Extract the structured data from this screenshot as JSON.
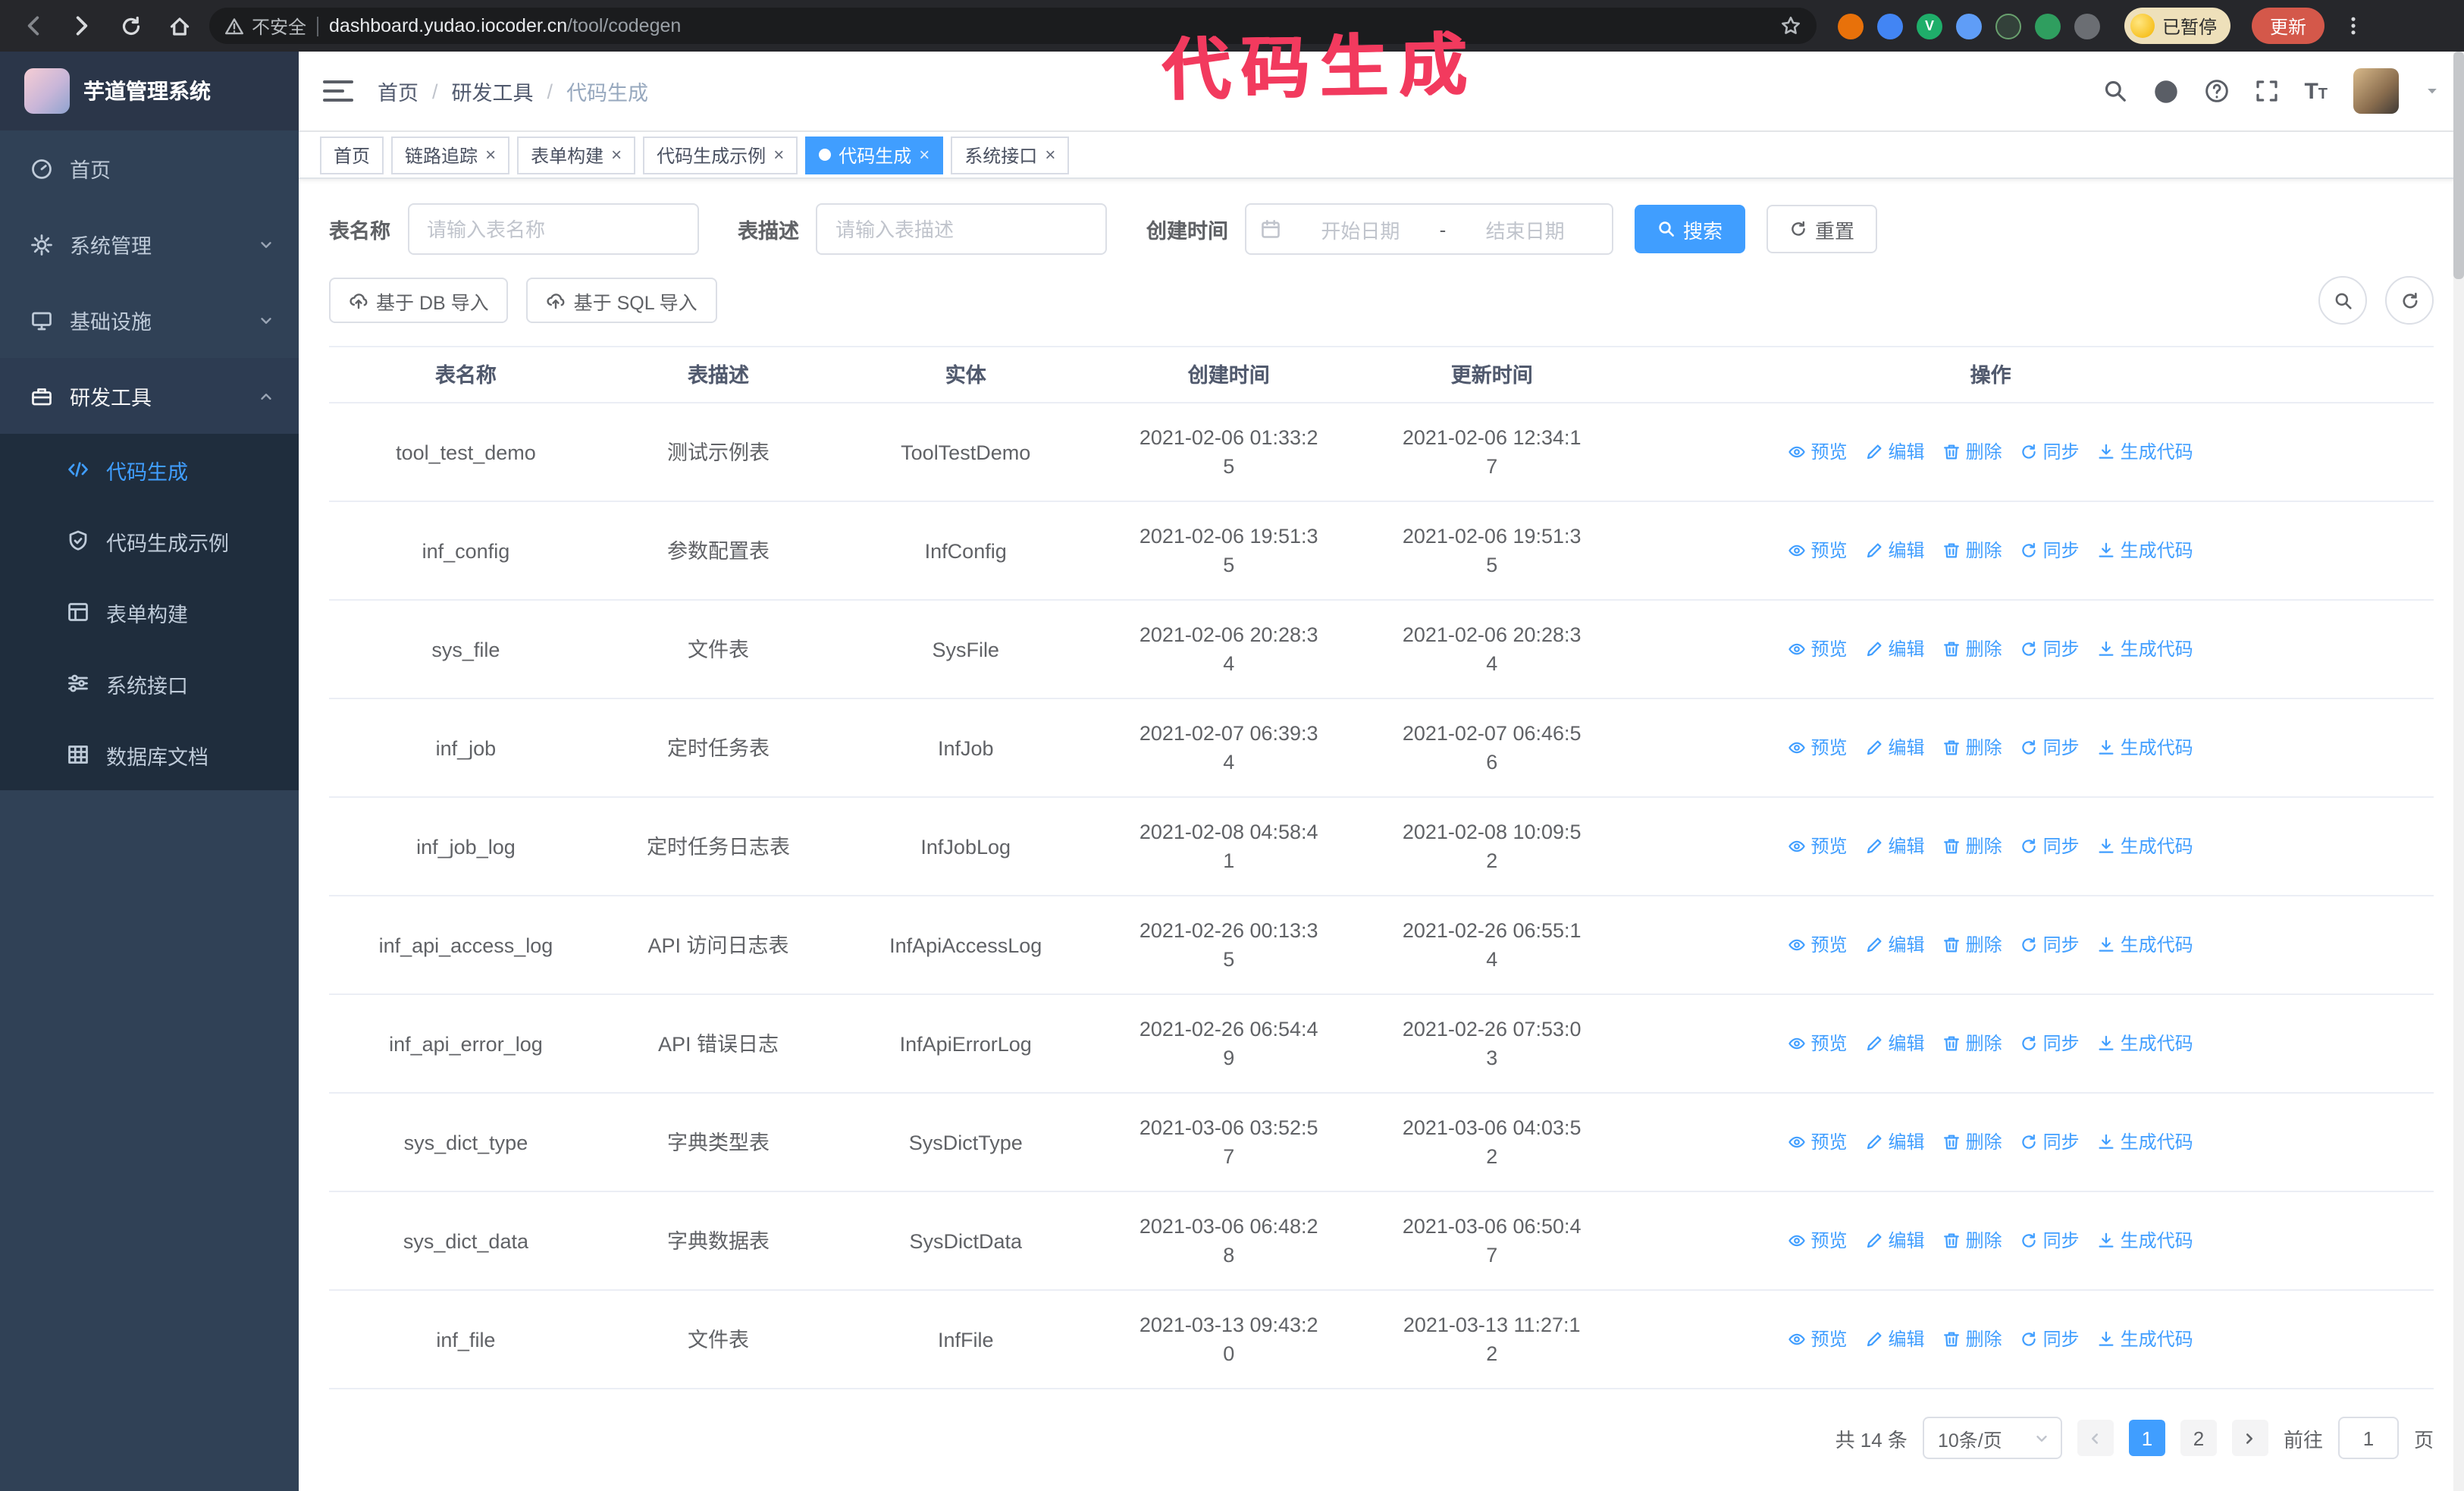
{
  "colors": {
    "accent": "#409eff",
    "annotation": "#f23a5e",
    "sidebar_bg": "#304156",
    "submenu_bg": "#1f2d3d"
  },
  "annotation": {
    "text": "代码生成"
  },
  "browser": {
    "security_label": "不安全",
    "url_domain": "dashboard.yudao.iocoder.cn",
    "url_path": "/tool/codegen",
    "profile_badge": "已暂停",
    "update_label": "更新"
  },
  "app": {
    "logo_title": "芋道管理系统"
  },
  "sidebar": {
    "items": [
      {
        "label": "首页",
        "icon": "dashboard-icon"
      },
      {
        "label": "系统管理",
        "icon": "gear-icon"
      },
      {
        "label": "基础设施",
        "icon": "monitor-icon"
      },
      {
        "label": "研发工具",
        "icon": "toolbox-icon"
      }
    ],
    "sub_items": [
      {
        "label": "代码生成",
        "icon": "code-icon",
        "active": true
      },
      {
        "label": "代码生成示例",
        "icon": "shield-check-icon"
      },
      {
        "label": "表单构建",
        "icon": "form-icon"
      },
      {
        "label": "系统接口",
        "icon": "sliders-icon"
      },
      {
        "label": "数据库文档",
        "icon": "grid-icon"
      }
    ]
  },
  "breadcrumb": {
    "items": [
      "首页",
      "研发工具",
      "代码生成"
    ],
    "separator": "/"
  },
  "tabs": [
    {
      "label": "首页",
      "closable": false,
      "active": false
    },
    {
      "label": "链路追踪",
      "closable": true,
      "active": false
    },
    {
      "label": "表单构建",
      "closable": true,
      "active": false
    },
    {
      "label": "代码生成示例",
      "closable": true,
      "active": false
    },
    {
      "label": "代码生成",
      "closable": true,
      "active": true
    },
    {
      "label": "系统接口",
      "closable": true,
      "active": false
    }
  ],
  "filters": {
    "table_name_label": "表名称",
    "table_name_placeholder": "请输入表名称",
    "table_desc_label": "表描述",
    "table_desc_placeholder": "请输入表描述",
    "create_time_label": "创建时间",
    "date_start_placeholder": "开始日期",
    "date_separator": "-",
    "date_end_placeholder": "结束日期",
    "search_label": "搜索",
    "reset_label": "重置"
  },
  "toolbar": {
    "import_db_label": "基于 DB 导入",
    "import_sql_label": "基于 SQL 导入"
  },
  "table": {
    "columns": [
      "表名称",
      "表描述",
      "实体",
      "创建时间",
      "更新时间",
      "操作"
    ],
    "action_labels": [
      "预览",
      "编辑",
      "删除",
      "同步",
      "生成代码"
    ],
    "rows": [
      {
        "name": "tool_test_demo",
        "desc": "测试示例表",
        "entity": "ToolTestDemo",
        "created": "2021-02-06 01:33:25",
        "updated": "2021-02-06 12:34:17"
      },
      {
        "name": "inf_config",
        "desc": "参数配置表",
        "entity": "InfConfig",
        "created": "2021-02-06 19:51:35",
        "updated": "2021-02-06 19:51:35"
      },
      {
        "name": "sys_file",
        "desc": "文件表",
        "entity": "SysFile",
        "created": "2021-02-06 20:28:34",
        "updated": "2021-02-06 20:28:34"
      },
      {
        "name": "inf_job",
        "desc": "定时任务表",
        "entity": "InfJob",
        "created": "2021-02-07 06:39:34",
        "updated": "2021-02-07 06:46:56"
      },
      {
        "name": "inf_job_log",
        "desc": "定时任务日志表",
        "entity": "InfJobLog",
        "created": "2021-02-08 04:58:41",
        "updated": "2021-02-08 10:09:52"
      },
      {
        "name": "inf_api_access_log",
        "desc": "API 访问日志表",
        "entity": "InfApiAccessLog",
        "created": "2021-02-26 00:13:35",
        "updated": "2021-02-26 06:55:14"
      },
      {
        "name": "inf_api_error_log",
        "desc": "API 错误日志",
        "entity": "InfApiErrorLog",
        "created": "2021-02-26 06:54:49",
        "updated": "2021-02-26 07:53:03"
      },
      {
        "name": "sys_dict_type",
        "desc": "字典类型表",
        "entity": "SysDictType",
        "created": "2021-03-06 03:52:57",
        "updated": "2021-03-06 04:03:52"
      },
      {
        "name": "sys_dict_data",
        "desc": "字典数据表",
        "entity": "SysDictData",
        "created": "2021-03-06 06:48:28",
        "updated": "2021-03-06 06:50:47"
      },
      {
        "name": "inf_file",
        "desc": "文件表",
        "entity": "InfFile",
        "created": "2021-03-13 09:43:20",
        "updated": "2021-03-13 11:27:12"
      }
    ]
  },
  "pagination": {
    "total_label": "共 14 条",
    "page_size_label": "10条/页",
    "pages": [
      "1",
      "2"
    ],
    "active_page": "1",
    "goto_prefix": "前往",
    "goto_value": "1",
    "goto_suffix": "页"
  }
}
